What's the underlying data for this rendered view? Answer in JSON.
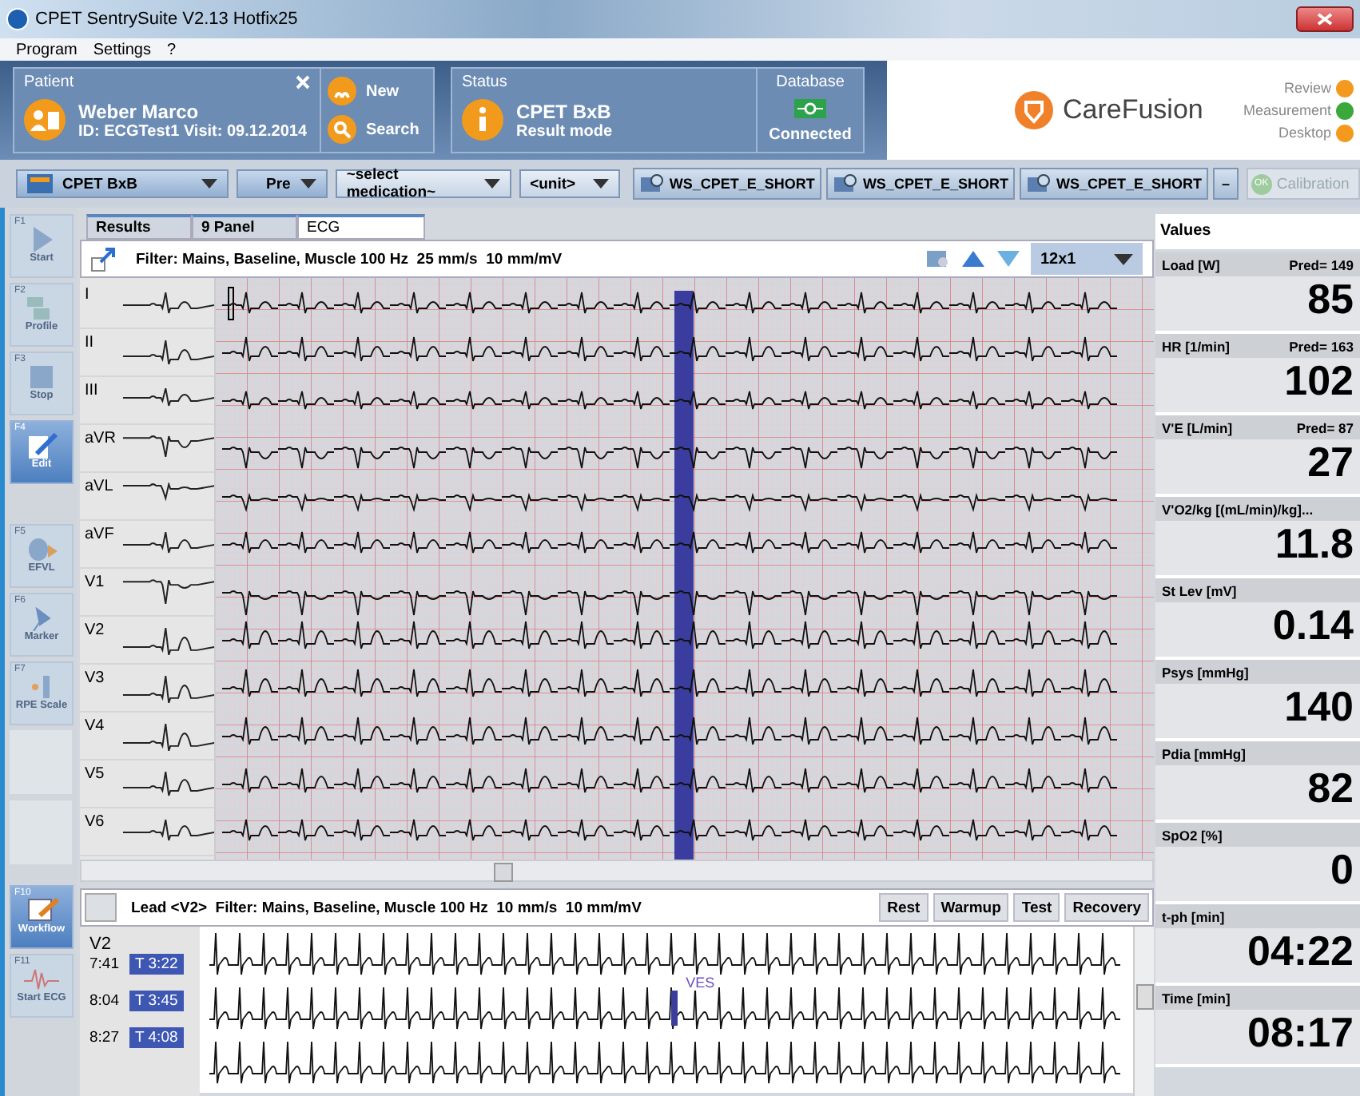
{
  "window": {
    "title": "CPET  SentrySuite  V2.13 Hotfix25"
  },
  "menu": [
    "Program",
    "Settings",
    "?"
  ],
  "patient": {
    "label": "Patient",
    "name": "Weber Marco",
    "id": "ID: ECGTest1 Visit: 09.12.2014",
    "actions": [
      "New",
      "Search"
    ]
  },
  "status": {
    "label": "Status",
    "title": "CPET BxB",
    "subtitle": "Result mode"
  },
  "database": {
    "label": "Database",
    "state": "Connected"
  },
  "logo": "CareFusion",
  "modes": [
    {
      "label": "Review",
      "color": "#f39a1e"
    },
    {
      "label": "Measurement",
      "color": "#3aa83a"
    },
    {
      "label": "Desktop",
      "color": "#f39a1e"
    }
  ],
  "toolbar": {
    "dropdowns": [
      "CPET BxB",
      "Pre",
      "~select medication~",
      "<unit>"
    ],
    "workspaces": [
      "WS_CPET_E_SHORT",
      "WS_CPET_E_SHORT",
      "WS_CPET_E_SHORT"
    ],
    "minimize": "–",
    "calibration": {
      "badge": "OK",
      "label": "Calibration",
      "disabled": true
    }
  },
  "fkeys": {
    "top": [
      {
        "key": "F1",
        "label": "Start",
        "disabled": true
      },
      {
        "key": "F2",
        "label": "Profile",
        "disabled": true
      },
      {
        "key": "F3",
        "label": "Stop",
        "disabled": true
      },
      {
        "key": "F4",
        "label": "Edit",
        "disabled": false
      }
    ],
    "middle": [
      {
        "key": "F5",
        "label": "EFVL",
        "disabled": true
      },
      {
        "key": "F6",
        "label": "Marker",
        "disabled": true
      },
      {
        "key": "F7",
        "label": "RPE Scale",
        "disabled": true
      }
    ],
    "bottom": [
      {
        "key": "F10",
        "label": "Workflow",
        "disabled": false
      },
      {
        "key": "F11",
        "label": "Start ECG",
        "disabled": true
      }
    ]
  },
  "tabs": [
    {
      "label": "Results",
      "selected": false
    },
    {
      "label": "9 Panel",
      "selected": false
    },
    {
      "label": "ECG",
      "selected": true
    }
  ],
  "ecg": {
    "filter": "Filter: Mains, Baseline, Muscle 100 Hz  25 mm/s  10 mm/mV",
    "layout": "12x1",
    "leads": [
      "I",
      "II",
      "III",
      "aVR",
      "aVL",
      "aVF",
      "V1",
      "V2",
      "V3",
      "V4",
      "V5",
      "V6"
    ]
  },
  "rhythm": {
    "info": "Lead <V2>  Filter: Mains, Baseline, Muscle 100 Hz  10 mm/s  10 mm/mV",
    "phases": [
      "Rest",
      "Warmup",
      "Test",
      "Recovery"
    ],
    "lead": "V2",
    "event": "VES",
    "rows": [
      {
        "time": "7:41",
        "tag": "T 3:22"
      },
      {
        "time": "8:04",
        "tag": "T 3:45"
      },
      {
        "time": "8:27",
        "tag": "T 4:08"
      }
    ]
  },
  "values": {
    "title": "Values",
    "items": [
      {
        "label": "Load  [W]",
        "pred": "Pred= 149",
        "value": "85"
      },
      {
        "label": "HR  [1/min]",
        "pred": "Pred= 163",
        "value": "102"
      },
      {
        "label": "V'E  [L/min]",
        "pred": "Pred=  87",
        "value": "27"
      },
      {
        "label": "V'O2/kg  [(mL/min)/kg]...",
        "value": "11.8"
      },
      {
        "label": "St Lev [mV]",
        "value": "0.14"
      },
      {
        "label": "Psys  [mmHg]",
        "value": "140"
      },
      {
        "label": "Pdia  [mmHg]",
        "value": "82"
      },
      {
        "label": "SpO2  [%]",
        "value": "0"
      },
      {
        "label": "t-ph  [min]",
        "value": "04:22"
      },
      {
        "label": "Time  [min]",
        "value": "08:17"
      }
    ]
  }
}
